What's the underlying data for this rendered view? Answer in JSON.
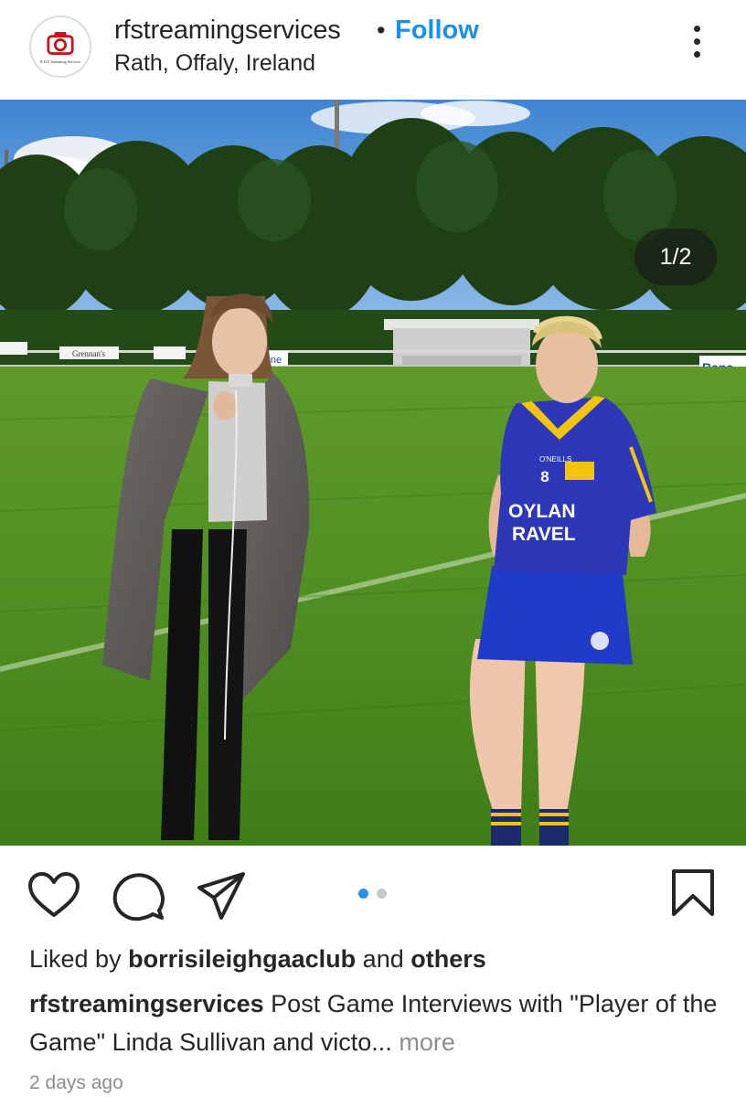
{
  "post": {
    "username": "rfstreamingservices",
    "separator": "•",
    "follow_label": "Follow",
    "location": "Rath, Offaly, Ireland",
    "avatar_text": "R D F Streaming Services"
  },
  "media": {
    "counter": "1/2",
    "carousel_count": 2,
    "carousel_active": 1,
    "signs": {
      "left": "Grennan's",
      "middle": "ne",
      "right": "Bana"
    },
    "jersey": {
      "number": "8",
      "brand": "O'NEILLS",
      "sponsor_line1": "OYLAN",
      "sponsor_line2": "RAVEL"
    },
    "icons": [
      "person-tag-icon"
    ]
  },
  "actions": {
    "icons": [
      "heart-icon",
      "comment-icon",
      "share-icon",
      "bookmark-icon"
    ]
  },
  "engagement": {
    "liked_prefix": "Liked by",
    "liked_user": "borrisileighgaaclub",
    "liked_and": "and",
    "liked_others": "others"
  },
  "caption": {
    "username": "rfstreamingservices",
    "text": "Post Game Interviews with \"Player of the Game\" Linda Sullivan and victo...",
    "more_label": "more"
  },
  "timestamp": "2 days ago",
  "colors": {
    "accent": "#1a8ff0",
    "text": "#262626",
    "muted": "#8e8e8e",
    "carousel_dot_active": "#2b8ff0",
    "carousel_dot_inactive": "#c7c7c7"
  }
}
